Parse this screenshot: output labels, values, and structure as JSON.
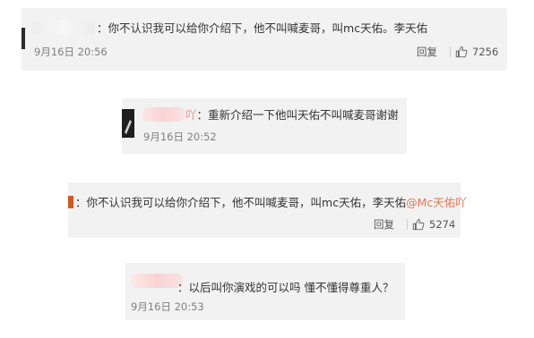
{
  "comments": [
    {
      "separator": "：",
      "text": "你不认识我可以给你介绍下，他不叫喊麦哥，叫mc天佑。李天佑",
      "time": "9月16日 20:56",
      "reply_label": "回复",
      "like_count": "7256"
    },
    {
      "name_suffix": "吖",
      "separator": "：",
      "text": "重新介绍一下他叫天佑不叫喊麦哥谢谢",
      "time": "9月16日 20:52"
    },
    {
      "separator": "：",
      "text": "你不认识我可以给你介绍下，他不叫喊麦哥，叫mc天佑，李天佑",
      "mention": "@Mc天佑吖",
      "reply_label": "回复",
      "like_count": "5274"
    },
    {
      "separator": "：",
      "text": "以后叫你演戏的可以吗 懂不懂得尊重人？",
      "time": "9月16日 20:53"
    }
  ],
  "colors": {
    "card_bg": "#f2f2f2",
    "mention": "#eb7350",
    "time": "#808080",
    "text": "#333333"
  },
  "icons": {
    "like": "thumbs-up-icon"
  }
}
